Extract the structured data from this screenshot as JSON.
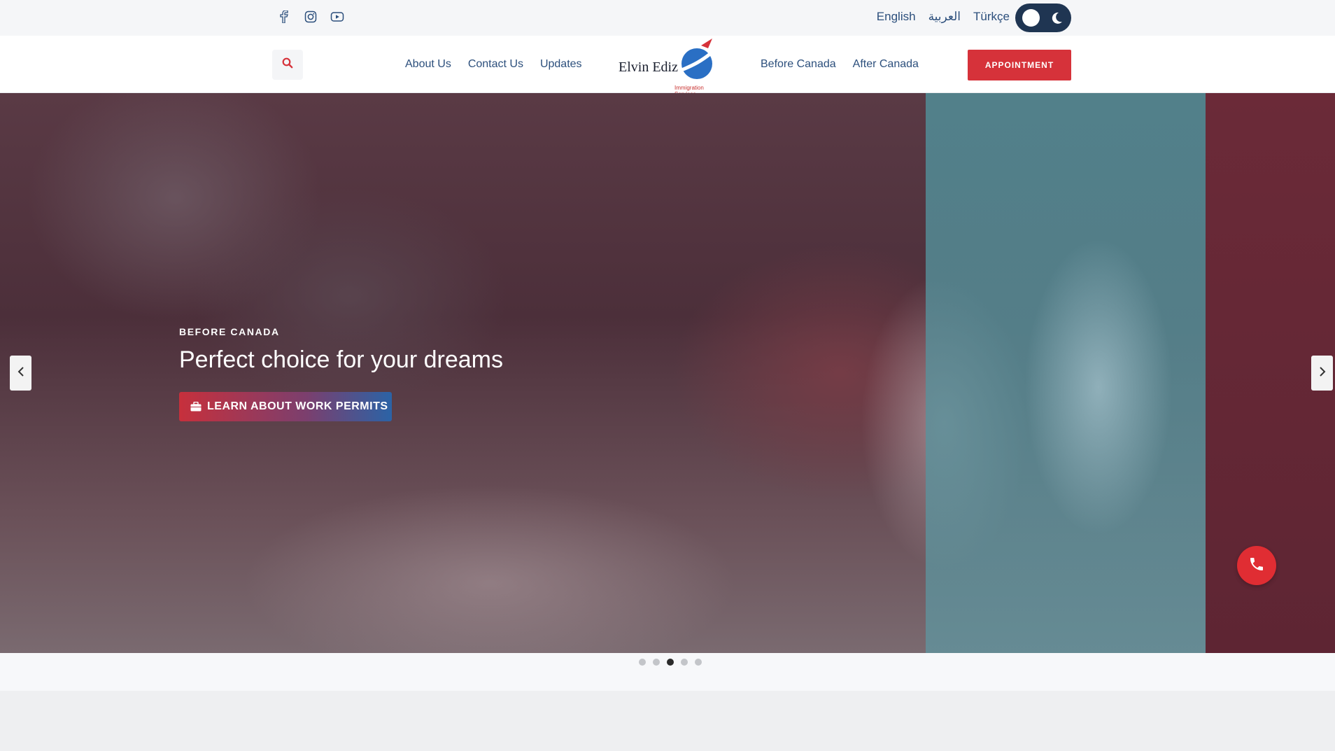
{
  "topbar": {
    "social": [
      "facebook-icon",
      "instagram-icon",
      "youtube-icon"
    ],
    "languages": [
      "English",
      "العربية",
      "Türkçe"
    ]
  },
  "header": {
    "nav_left": [
      "About Us",
      "Contact Us",
      "Updates"
    ],
    "nav_right": [
      "Before Canada",
      "After Canada"
    ],
    "logo_text": "Elvin Ediz",
    "logo_sub": "Immigration Services",
    "appointment_label": "APPOINTMENT"
  },
  "hero": {
    "eyebrow": "BEFORE CANADA",
    "title": "Perfect choice for your dreams",
    "cta_label": "LEARN ABOUT WORK PERMITS",
    "slides_total": 5,
    "active_slide": 3
  },
  "colors": {
    "accent_red": "#d6323a",
    "nav_blue": "#2c4f7c",
    "toggle_bg": "#1f3552"
  }
}
